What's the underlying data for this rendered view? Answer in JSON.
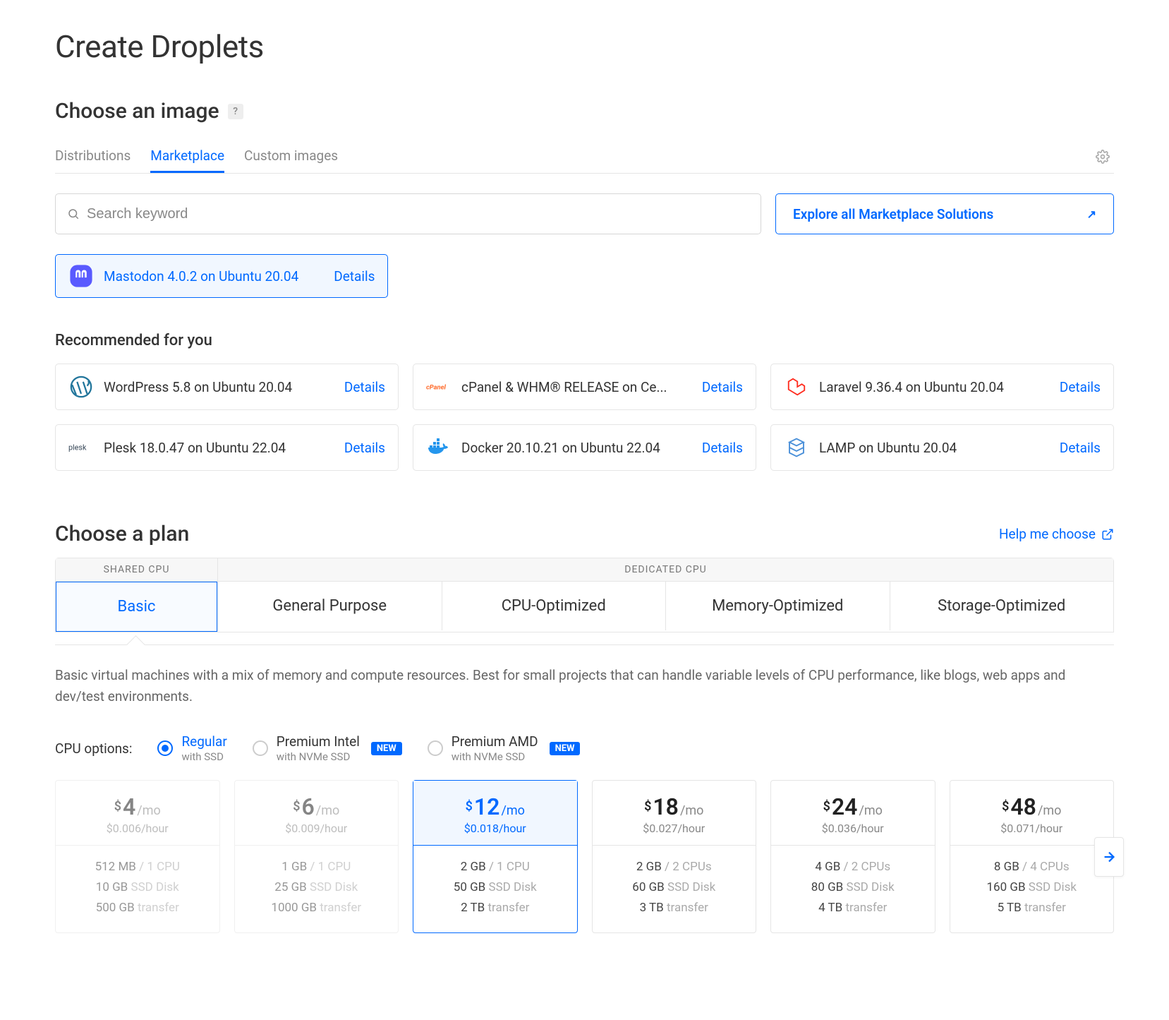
{
  "title": "Create Droplets",
  "image_section": {
    "heading": "Choose an image",
    "tabs": [
      "Distributions",
      "Marketplace",
      "Custom images"
    ],
    "active_tab": 1,
    "search_placeholder": "Search keyword",
    "explore_label": "Explore all Marketplace Solutions",
    "selected": {
      "label": "Mastodon 4.0.2 on Ubuntu 20.04",
      "details": "Details"
    },
    "recommended_heading": "Recommended for you",
    "recommended": [
      {
        "label": "WordPress 5.8 on Ubuntu 20.04",
        "details": "Details",
        "icon": "wordpress"
      },
      {
        "label": "cPanel & WHM® RELEASE on Ce...",
        "details": "Details",
        "icon": "cpanel"
      },
      {
        "label": "Laravel 9.36.4 on Ubuntu 20.04",
        "details": "Details",
        "icon": "laravel"
      },
      {
        "label": "Plesk 18.0.47 on Ubuntu 22.04",
        "details": "Details",
        "icon": "plesk"
      },
      {
        "label": "Docker 20.10.21 on Ubuntu 22.04",
        "details": "Details",
        "icon": "docker"
      },
      {
        "label": "LAMP on Ubuntu 20.04",
        "details": "Details",
        "icon": "lamp"
      }
    ]
  },
  "plan_section": {
    "heading": "Choose a plan",
    "help_link": "Help me choose",
    "shared_label": "SHARED CPU",
    "dedicated_label": "DEDICATED CPU",
    "shared_tabs": [
      "Basic"
    ],
    "dedicated_tabs": [
      "General Purpose",
      "CPU-Optimized",
      "Memory-Optimized",
      "Storage-Optimized"
    ],
    "active_plan": "Basic",
    "description": "Basic virtual machines with a mix of memory and compute resources. Best for small projects that can handle variable levels of CPU performance, like blogs, web apps and dev/test environments.",
    "cpu_options_label": "CPU options:",
    "cpu_options": [
      {
        "name": "Regular",
        "sub": "with SSD",
        "new": false,
        "checked": true
      },
      {
        "name": "Premium Intel",
        "sub": "with NVMe SSD",
        "new": true,
        "checked": false
      },
      {
        "name": "Premium AMD",
        "sub": "with NVMe SSD",
        "new": true,
        "checked": false
      }
    ],
    "new_badge": "NEW",
    "prices": [
      {
        "amount": "4",
        "hour": "$0.006/hour",
        "ram": "512 MB",
        "cpu": "1 CPU",
        "disk": "10 GB",
        "disk_suffix": "SSD Disk",
        "transfer": "500 GB",
        "transfer_suffix": "transfer",
        "disabled": true,
        "selected": false
      },
      {
        "amount": "6",
        "hour": "$0.009/hour",
        "ram": "1 GB",
        "cpu": "1 CPU",
        "disk": "25 GB",
        "disk_suffix": "SSD Disk",
        "transfer": "1000 GB",
        "transfer_suffix": "transfer",
        "disabled": true,
        "selected": false
      },
      {
        "amount": "12",
        "hour": "$0.018/hour",
        "ram": "2 GB",
        "cpu": "1 CPU",
        "disk": "50 GB",
        "disk_suffix": "SSD Disk",
        "transfer": "2 TB",
        "transfer_suffix": "transfer",
        "disabled": false,
        "selected": true
      },
      {
        "amount": "18",
        "hour": "$0.027/hour",
        "ram": "2 GB",
        "cpu": "2 CPUs",
        "disk": "60 GB",
        "disk_suffix": "SSD Disk",
        "transfer": "3 TB",
        "transfer_suffix": "transfer",
        "disabled": false,
        "selected": false
      },
      {
        "amount": "24",
        "hour": "$0.036/hour",
        "ram": "4 GB",
        "cpu": "2 CPUs",
        "disk": "80 GB",
        "disk_suffix": "SSD Disk",
        "transfer": "4 TB",
        "transfer_suffix": "transfer",
        "disabled": false,
        "selected": false
      },
      {
        "amount": "48",
        "hour": "$0.071/hour",
        "ram": "8 GB",
        "cpu": "4 CPUs",
        "disk": "160 GB",
        "disk_suffix": "SSD Disk",
        "transfer": "5 TB",
        "transfer_suffix": "transfer",
        "disabled": false,
        "selected": false
      }
    ],
    "per_month": "/mo"
  }
}
